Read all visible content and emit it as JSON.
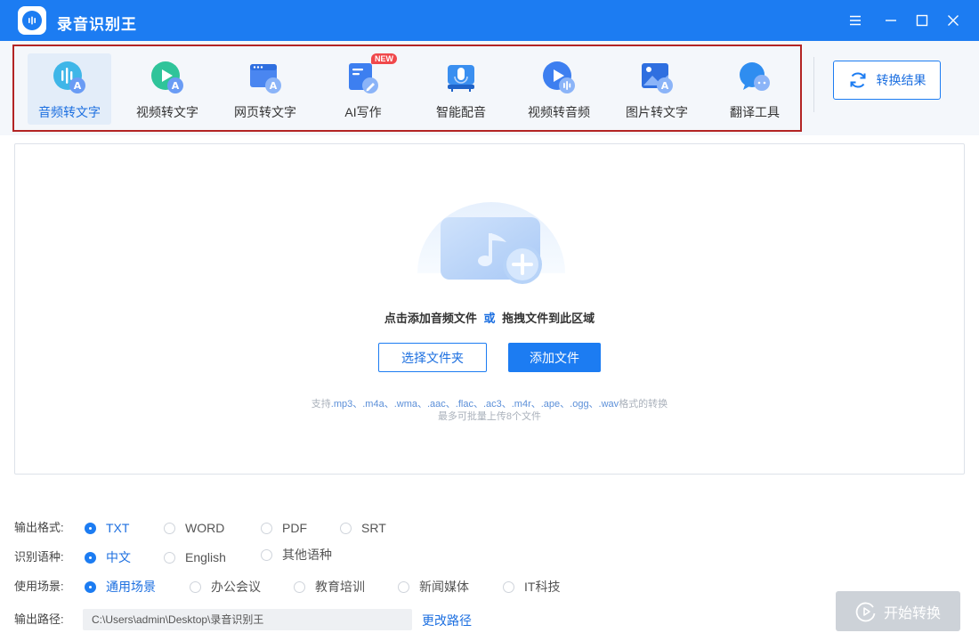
{
  "app": {
    "title": "录音识别王"
  },
  "toolbar": {
    "tools": [
      {
        "label": "音频转文字",
        "icon": "audio-to-text-icon"
      },
      {
        "label": "视频转文字",
        "icon": "video-to-text-icon"
      },
      {
        "label": "网页转文字",
        "icon": "webpage-to-text-icon"
      },
      {
        "label": "AI写作",
        "icon": "ai-writing-icon",
        "badge": "NEW"
      },
      {
        "label": "智能配音",
        "icon": "smart-dubbing-icon"
      },
      {
        "label": "视频转音频",
        "icon": "video-to-audio-icon"
      },
      {
        "label": "图片转文字",
        "icon": "image-to-text-icon"
      },
      {
        "label": "翻译工具",
        "icon": "translate-icon"
      }
    ],
    "active_index": 0,
    "result_button": "转换结果"
  },
  "dropzone": {
    "main_text_a": "点击添加音频文件",
    "main_text_or": "或",
    "main_text_b": "拖拽文件到此区域",
    "choose_folder": "选择文件夹",
    "add_file": "添加文件",
    "hint_prefix": "支持",
    "hint_formats": ".mp3、.m4a、.wma、.aac、.flac、.ac3、.m4r、.ape、.ogg、.wav",
    "hint_suffix": "格式的转换",
    "hint_line2": "最多可批量上传8个文件"
  },
  "options": {
    "output_format": {
      "label": "输出格式:",
      "choices": [
        "TXT",
        "WORD",
        "PDF",
        "SRT"
      ],
      "selected": "TXT"
    },
    "language": {
      "label": "识别语种:",
      "choices": [
        "中文",
        "English",
        "其他语种"
      ],
      "selected": "中文"
    },
    "scene": {
      "label": "使用场景:",
      "choices": [
        "通用场景",
        "办公会议",
        "教育培训",
        "新闻媒体",
        "IT科技"
      ],
      "selected": "通用场景"
    },
    "output_path": {
      "label": "输出路径:",
      "value": "C:\\Users\\admin\\Desktop\\录音识别王",
      "change": "更改路径"
    }
  },
  "start_button": "开始转换",
  "colors": {
    "accent": "#1c7cf2",
    "highlight_border": "#b32424",
    "disabled": "#cdd2d8"
  }
}
